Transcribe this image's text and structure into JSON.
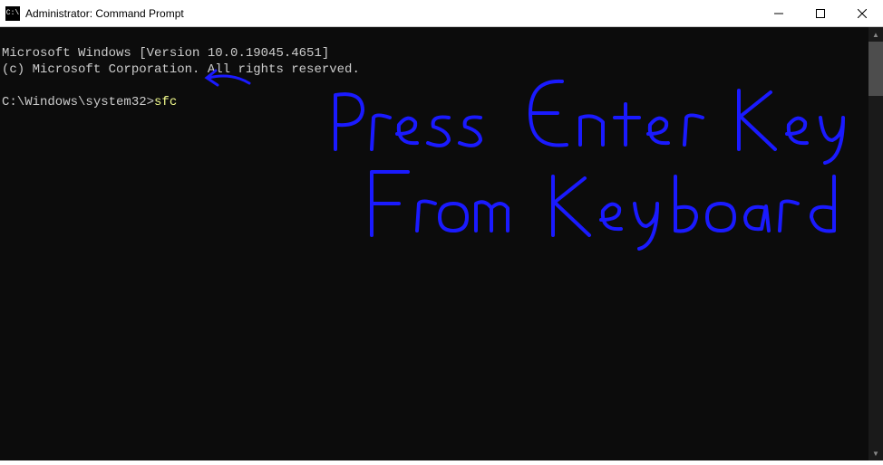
{
  "window": {
    "title": "Administrator: Command Prompt",
    "icon_label": "C:\\"
  },
  "terminal": {
    "line1": "Microsoft Windows [Version 10.0.19045.4651]",
    "line2": "(c) Microsoft Corporation. All rights reserved.",
    "prompt_path": "C:\\Windows\\system32>",
    "prompt_command": "sfc"
  },
  "annotation": {
    "text_line1": "Press Enter Key",
    "text_line2": "From Keyboard",
    "color": "#1a1aff"
  }
}
